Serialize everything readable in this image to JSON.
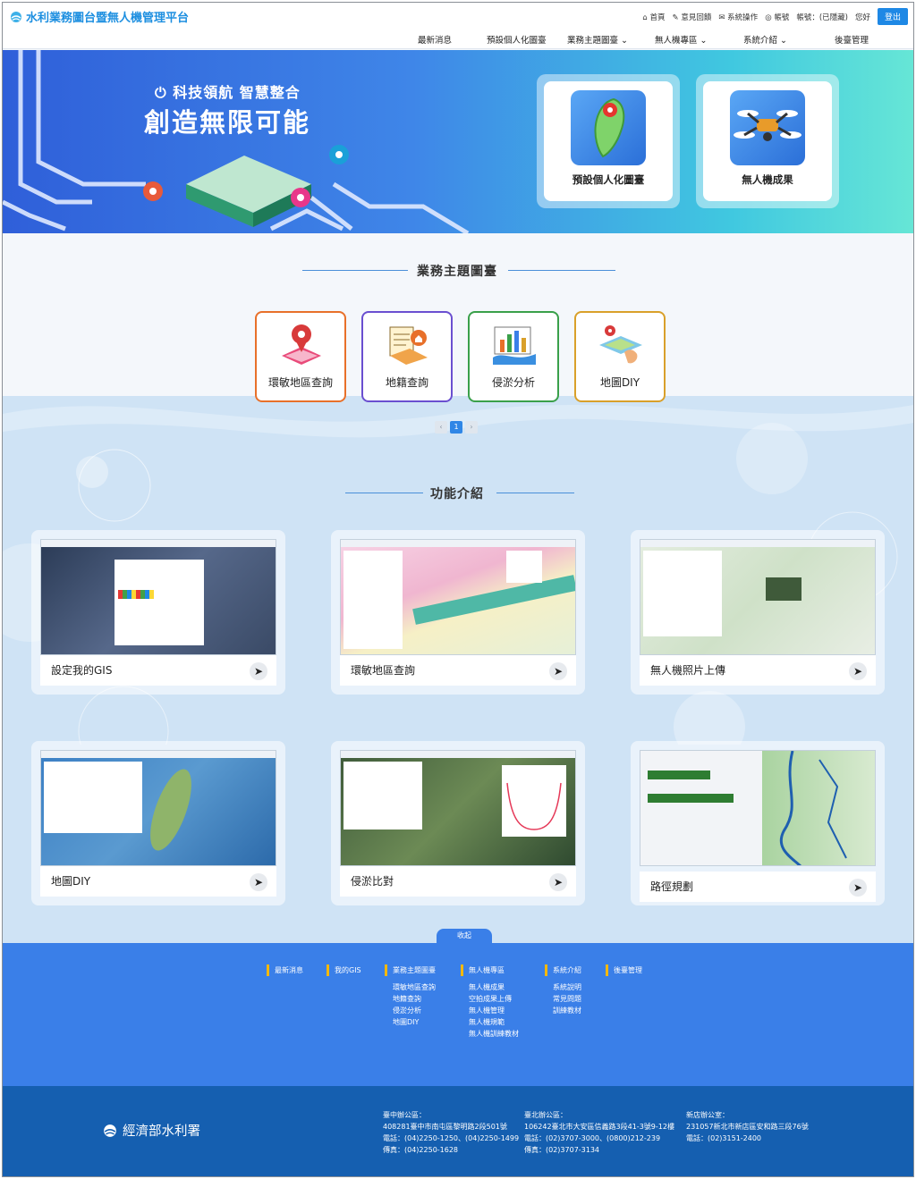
{
  "header": {
    "title": "水利業務圖台暨無人機管理平台",
    "util": {
      "home": "首頁",
      "feedback": "意見回饋",
      "drone_login": "系統操作",
      "account": "帳號",
      "user": "帳號：(已隱藏)",
      "greeting": "您好",
      "logout": "登出"
    },
    "nav": [
      {
        "label": "最新消息"
      },
      {
        "label": "預設個人化圖臺"
      },
      {
        "label": "業務主題圖臺 ⌄"
      },
      {
        "label": "無人機專區 ⌄"
      },
      {
        "label": "系統介紹 ⌄"
      },
      {
        "label": "後臺管理"
      }
    ]
  },
  "hero": {
    "slogan_top": "⏻ 科技領航 智慧整合",
    "slogan_main": "創造無限可能",
    "cards": [
      {
        "label": "預設個人化圖臺",
        "icon": "taiwan-map-icon"
      },
      {
        "label": "無人機成果",
        "icon": "drone-icon"
      }
    ]
  },
  "themes": {
    "title": "業務主題圖臺",
    "items": [
      {
        "label": "環敏地區查詢",
        "color": "#e8702a",
        "icon": "location-pin-map-icon"
      },
      {
        "label": "地籍查詢",
        "color": "#6a4fd0",
        "icon": "cadastre-map-icon"
      },
      {
        "label": "侵淤分析",
        "color": "#3aa04a",
        "icon": "sediment-chart-icon"
      },
      {
        "label": "地圖DIY",
        "color": "#d9a02a",
        "icon": "map-diy-hand-icon"
      }
    ],
    "pager": {
      "prev": "‹",
      "current": "1",
      "next": "›"
    }
  },
  "features": {
    "title": "功能介紹",
    "items": [
      {
        "label": "設定我的GIS"
      },
      {
        "label": "環敏地區查詢"
      },
      {
        "label": "無人機照片上傳"
      },
      {
        "label": "地圖DIY"
      },
      {
        "label": "侵淤比對"
      },
      {
        "label": "路徑規劃"
      }
    ],
    "collapse": "收起"
  },
  "footer_nav": {
    "columns": [
      {
        "head": "最新消息",
        "items": []
      },
      {
        "head": "我的GIS",
        "items": []
      },
      {
        "head": "業務主題圖臺",
        "items": [
          "環敏地區查詢",
          "地籍查詢",
          "侵淤分析",
          "地圖DIY"
        ]
      },
      {
        "head": "無人機專區",
        "items": [
          "無人機成果",
          "空拍成果上傳",
          "無人機管理",
          "無人機規範",
          "無人機訓練教材"
        ]
      },
      {
        "head": "系統介紹",
        "items": [
          "系統說明",
          "常見問題",
          "訓練教材"
        ]
      },
      {
        "head": "後臺管理",
        "items": []
      }
    ]
  },
  "footer": {
    "ministry": "經濟部水利署",
    "offices": [
      {
        "name": "臺中辦公區：",
        "addr": "408281臺中市南屯區黎明路2段501號",
        "tel": "電話：(04)2250-1250、(04)2250-1499",
        "fax": "傳真：(04)2250-1628"
      },
      {
        "name": "臺北辦公區：",
        "addr": "106242臺北市大安區信義路3段41-3號9-12樓",
        "tel": "電話：(02)3707-3000、(0800)212-239",
        "fax": "傳真：(02)3707-3134"
      },
      {
        "name": "新店辦公室：",
        "addr": "231057新北市新店區安和路三段76號",
        "tel": "電話：(02)3151-2400",
        "fax": ""
      }
    ]
  }
}
